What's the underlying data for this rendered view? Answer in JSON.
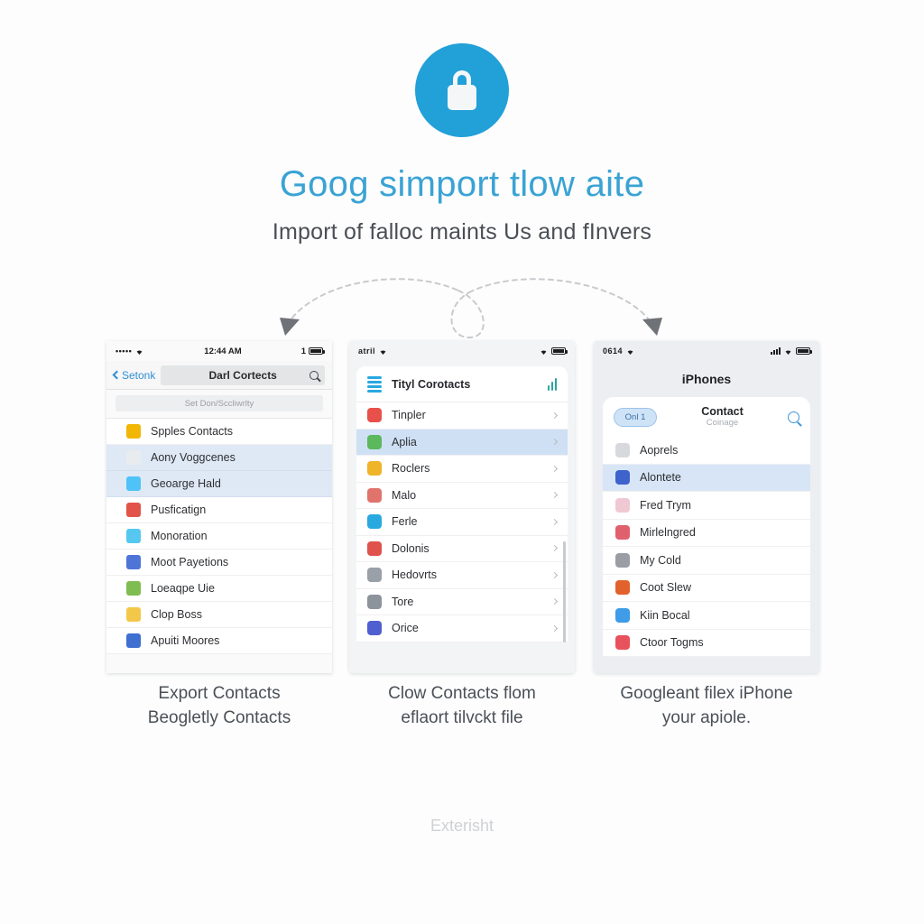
{
  "header": {
    "icon": "lock-icon",
    "icon_color": "#22a0d8",
    "title": "Goog simport tlow aite",
    "title_color": "#3aa3d4",
    "subtitle": "Import of falloc maints Us and fInvers"
  },
  "connectors": {
    "style": "dashed-arc-with-loop",
    "color": "#c9cace",
    "left_arrowhead": true,
    "right_arrowhead": true
  },
  "phones": [
    {
      "name": "phone-export",
      "status": {
        "left_signal": "•••••",
        "wifi": "wifi-icon",
        "time": "12:44 AM",
        "battery": "1"
      },
      "nav": {
        "back_label": "Setonk",
        "search_value": "Darl Cortects",
        "search_icon": "search-icon"
      },
      "subbar": "Set Don/Sccliwrlty",
      "rows": [
        {
          "label": "Spples Contacts",
          "icon_color": "#f2b705",
          "selected": false
        },
        {
          "label": "Aony Voggcenes",
          "icon_color": "#e9ecef",
          "selected": true
        },
        {
          "label": "Geoarge Hald",
          "icon_color": "#4fc3f7",
          "selected": true
        },
        {
          "label": "Pusficatign",
          "icon_color": "#e2544a",
          "selected": false
        },
        {
          "label": "Monoration",
          "icon_color": "#56c8ef",
          "selected": false
        },
        {
          "label": "Moot Payetions",
          "icon_color": "#4f74d8",
          "selected": false
        },
        {
          "label": "Loeaqpe Uie",
          "icon_color": "#7fbd52",
          "selected": false
        },
        {
          "label": "Clop Boss",
          "icon_color": "#f3c84a",
          "selected": false
        },
        {
          "label": "Apuiti Moores",
          "icon_color": "#3f6fd0",
          "selected": false
        }
      ],
      "caption": "Export Contacts\nBeogletly Contacts"
    },
    {
      "name": "phone-cloud",
      "status": {
        "left_signal": "atril",
        "wifi": "wifi-icon",
        "battery": "battery-icon"
      },
      "nav": {
        "logo": "stack-icon",
        "title": "Tityl Corotacts",
        "action_icon": "chart-icon"
      },
      "rows": [
        {
          "label": "Tinpler",
          "icon_color": "#e8514b",
          "selected": false
        },
        {
          "label": "Aplia",
          "icon_color": "#5cb85c",
          "selected": true
        },
        {
          "label": "Roclers",
          "icon_color": "#f0b429",
          "selected": false
        },
        {
          "label": "Malo",
          "icon_color": "#e0746c",
          "selected": false
        },
        {
          "label": "Ferle",
          "icon_color": "#2aa9e0",
          "selected": false
        },
        {
          "label": "Dolonis",
          "icon_color": "#e0524c",
          "selected": false
        },
        {
          "label": "Hedovrts",
          "icon_color": "#9aa0a8",
          "selected": false
        },
        {
          "label": "Tore",
          "icon_color": "#8d939b",
          "selected": false
        },
        {
          "label": "Orice",
          "icon_color": "#4f5fd0",
          "selected": false
        }
      ],
      "caption": "Clow Contacts flom\neflaort tilvckt file"
    },
    {
      "name": "phone-iphone",
      "status": {
        "left_signal": "0614",
        "wifi": "wifi-icon",
        "battery": "battery-icon"
      },
      "title": "iPhones",
      "head": {
        "pill": "Onl 1",
        "title": "Contact",
        "subtitle": "Coinage",
        "search_icon": "search-icon"
      },
      "rows": [
        {
          "label": "Aoprels",
          "icon_color": "#d7d9dd",
          "selected": false
        },
        {
          "label": "Alontete",
          "icon_color": "#3e63cc",
          "selected": true
        },
        {
          "label": "Fred Trym",
          "icon_color": "#f0c8d4",
          "selected": false
        },
        {
          "label": "Mirlelngred",
          "icon_color": "#e0616e",
          "selected": false
        },
        {
          "label": "My Cold",
          "icon_color": "#9a9ea4",
          "selected": false
        },
        {
          "label": "Coot Slew",
          "icon_color": "#e2622d",
          "selected": false
        },
        {
          "label": "Kiin Bocal",
          "icon_color": "#3f9ce8",
          "selected": false
        },
        {
          "label": "Ctoor Togms",
          "icon_color": "#e8525c",
          "selected": false
        }
      ],
      "caption": "Googleant filex iPhone\nyour apiole."
    }
  ],
  "footer": {
    "label": "Exterisht"
  }
}
